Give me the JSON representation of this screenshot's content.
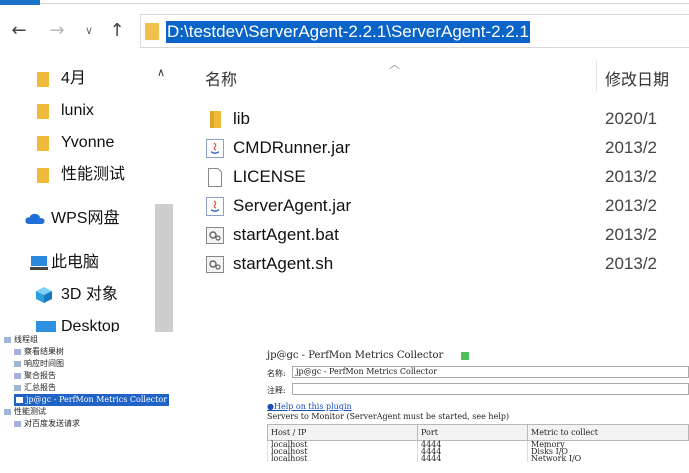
{
  "explorer": {
    "address_path": "D:\\testdev\\ServerAgent-2.2.1\\ServerAgent-2.2.1",
    "nav": {
      "back": "←",
      "forward": "→",
      "recent": "∨",
      "up": "↑"
    },
    "sidebar": [
      {
        "label": "4月",
        "icon": "folder-icon"
      },
      {
        "label": "lunix",
        "icon": "folder-icon"
      },
      {
        "label": "Yvonne",
        "icon": "folder-icon"
      },
      {
        "label": "性能测试",
        "icon": "folder-icon"
      },
      {
        "label": "WPS网盘",
        "icon": "cloud-icon"
      },
      {
        "label": "此电脑",
        "icon": "computer-icon"
      },
      {
        "label": "3D 对象",
        "icon": "cube-icon"
      },
      {
        "label": "Desktop",
        "icon": "desktop-icon"
      }
    ],
    "columns": {
      "name": "名称",
      "modified": "修改日期"
    },
    "files": [
      {
        "name": "lib",
        "date": "2020/1",
        "icon": "folder-icon"
      },
      {
        "name": "CMDRunner.jar",
        "date": "2013/2",
        "icon": "java-jar-icon"
      },
      {
        "name": "LICENSE",
        "date": "2013/2",
        "icon": "file-icon"
      },
      {
        "name": "ServerAgent.jar",
        "date": "2013/2",
        "icon": "java-jar-icon"
      },
      {
        "name": "startAgent.bat",
        "date": "2013/2",
        "icon": "script-icon"
      },
      {
        "name": "startAgent.sh",
        "date": "2013/2",
        "icon": "script-icon"
      }
    ],
    "colors": {
      "selection": "#0a64c8",
      "folder": "#f0b93a",
      "accent": "#1a73c9"
    }
  },
  "jmeter": {
    "tree": [
      "线程组",
      "察看结果树",
      "响应时间图",
      "聚合报告",
      "汇总报告",
      "jp@gc - PerfMon Metrics Collector",
      "性能测试",
      "对百度发送请求"
    ],
    "panel": {
      "title": "jp@gc - PerfMon Metrics Collector",
      "name_label": "名称:",
      "name_value": "jp@gc - PerfMon Metrics Collector",
      "comment_label": "注释:",
      "help_link": "Help on this plugin",
      "servers_label": "Servers to Monitor (ServerAgent must be started, see help)",
      "table": {
        "headers": [
          "Host / IP",
          "Port",
          "Metric to collect"
        ],
        "rows": [
          [
            "localhost",
            "4444",
            "Memory"
          ],
          [
            "localhost",
            "4444",
            "Disks I/O"
          ],
          [
            "localhost",
            "4444",
            "Network I/O"
          ]
        ]
      }
    }
  }
}
